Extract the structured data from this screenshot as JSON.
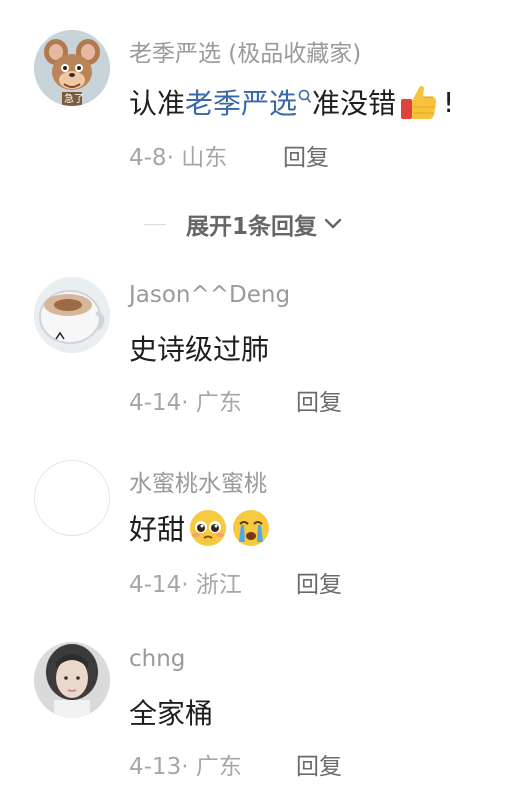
{
  "comments": [
    {
      "username": "老季严选 (极品收藏家)",
      "content_prefix": "认准",
      "content_link": "老季严选",
      "content_suffix": "准没错",
      "content_tail": "!",
      "date": "4-8",
      "location": "山东",
      "reply": "回复",
      "avatar_icon": "cartoon-mouse-avatar",
      "avatar_text": "急了"
    },
    {
      "username": "Jason^^Deng",
      "content": "史诗级过肺",
      "date": "4-14",
      "location": "广东",
      "reply": "回复",
      "avatar_icon": "coffee-cup-avatar"
    },
    {
      "username": "水蜜桃水蜜桃",
      "content": "好甜",
      "date": "4-14",
      "location": "浙江",
      "reply": "回复",
      "avatar_icon": "blank-avatar"
    },
    {
      "username": "chng",
      "content": "全家桶",
      "date": "4-13",
      "location": "广东",
      "reply": "回复",
      "avatar_icon": "person-photo-avatar"
    }
  ],
  "expand_replies": {
    "label": "展开1条回复",
    "icon": "chevron-down-icon"
  },
  "colors": {
    "link": "#3a67a8",
    "username": "#9a9a9a",
    "meta": "#a6a6a6",
    "content": "#1e1e1e"
  }
}
